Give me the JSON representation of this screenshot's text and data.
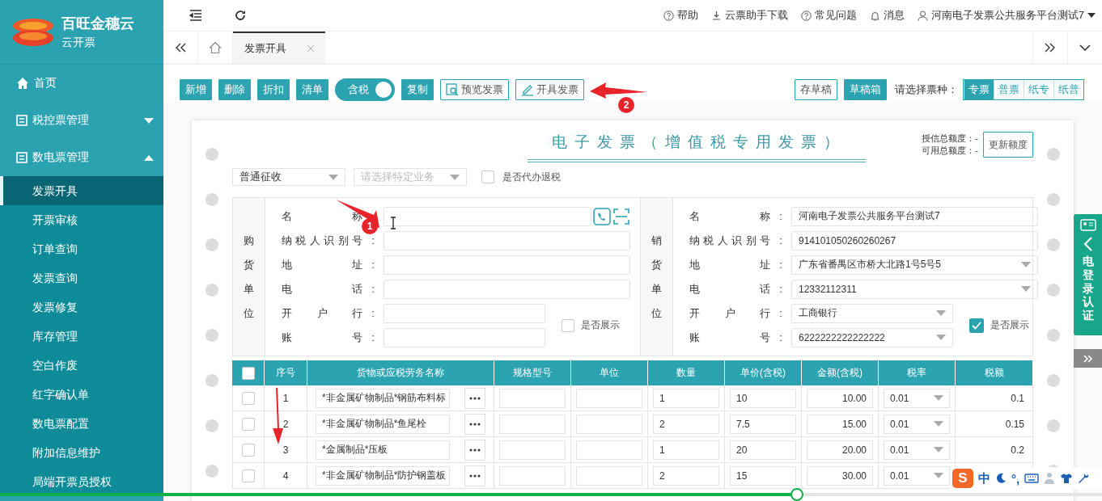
{
  "sidebar": {
    "logo": {
      "title": "百旺金穗云",
      "subtitle": "云开票"
    },
    "items": [
      {
        "kind": "home",
        "label": "首页"
      },
      {
        "kind": "group",
        "label": "税控票管理",
        "expanded": false
      },
      {
        "kind": "group",
        "label": "数电票管理",
        "expanded": true,
        "children": [
          {
            "label": "发票开具",
            "selected": true
          },
          {
            "label": "开票审核",
            "selected": false
          },
          {
            "label": "订单查询",
            "selected": false
          },
          {
            "label": "发票查询",
            "selected": false
          },
          {
            "label": "发票修复",
            "selected": false
          },
          {
            "label": "库存管理",
            "selected": false
          },
          {
            "label": "空白作废",
            "selected": false
          },
          {
            "label": "红字确认单",
            "selected": false
          },
          {
            "label": "数电票配置",
            "selected": false
          },
          {
            "label": "附加信息维护",
            "selected": false
          },
          {
            "label": "局端开票员授权",
            "selected": false
          }
        ]
      }
    ]
  },
  "header": {
    "links": [
      {
        "kind": "help",
        "label": "帮助"
      },
      {
        "kind": "download",
        "label": "云票助手下载"
      },
      {
        "kind": "help",
        "label": "常见问题"
      },
      {
        "kind": "bell",
        "label": "消息"
      }
    ],
    "user": "河南电子发票公共服务平台测试7"
  },
  "tabs": [
    {
      "label": "发票开具",
      "selected": true
    }
  ],
  "toolbar": {
    "left": [
      {
        "kind": "filled",
        "label": "新增"
      },
      {
        "kind": "filled",
        "label": "删除"
      },
      {
        "kind": "filled",
        "label": "折扣"
      },
      {
        "kind": "filled",
        "label": "清单"
      },
      {
        "kind": "toggle",
        "label": "含税",
        "on": true
      },
      {
        "kind": "filled",
        "label": "复制"
      },
      {
        "kind": "outline",
        "label": "预览发票"
      },
      {
        "kind": "outline",
        "label": "开具发票"
      }
    ],
    "right": [
      {
        "kind": "outline",
        "label": "存草稿"
      },
      {
        "kind": "filled",
        "label": "草稿箱"
      }
    ],
    "type_label": "请选择票种：",
    "types": [
      {
        "label": "专票",
        "selected": true
      },
      {
        "label": "普票",
        "selected": false
      },
      {
        "label": "纸专",
        "selected": false
      },
      {
        "label": "纸普",
        "selected": false
      }
    ]
  },
  "invoice": {
    "title": "电子发票（增值税专用发票）",
    "quota": [
      "授信总额度：-",
      "可用总额度：-"
    ],
    "quota_button": "更新额度",
    "levy": {
      "value": "普通征收"
    },
    "business": {
      "placeholder": "请选择特定业务"
    },
    "refund": {
      "label": "是否代办退税",
      "checked": false
    },
    "parties": [
      {
        "side_label": "购货单位",
        "fields": [
          {
            "kind": "lookup",
            "label": "名称"
          },
          {
            "kind": "text",
            "label": "纳税人识别号",
            "sep": ":"
          },
          {
            "kind": "text",
            "label": "地址",
            "sep": ":"
          },
          {
            "kind": "text",
            "label": "电话",
            "sep": ":"
          },
          {
            "kind": "text",
            "label": "开户行",
            "sep": ":"
          },
          {
            "kind": "text",
            "label": "账号",
            "sep": ":"
          }
        ],
        "show": {
          "label": "是否展示",
          "checked": false
        }
      },
      {
        "side_label": "销货单位",
        "fields": [
          {
            "kind": "text",
            "label": "名称",
            "sep": ":",
            "value": "河南电子发票公共服务平台测试7"
          },
          {
            "kind": "text",
            "label": "纳税人识别号",
            "sep": ":",
            "value": "914101050260260267"
          },
          {
            "kind": "select",
            "label": "地址",
            "sep": ":",
            "value": "广东省番禺区市桥大北路1号5号5"
          },
          {
            "kind": "select",
            "label": "电话",
            "sep": ":",
            "value": "12332112311"
          },
          {
            "kind": "select",
            "label": "开户行",
            "sep": ":",
            "value": "工商银行"
          },
          {
            "kind": "select",
            "label": "账号",
            "sep": ":",
            "value": "6222222222222222"
          }
        ],
        "show": {
          "label": "是否展示",
          "checked": true
        }
      }
    ],
    "table": {
      "all_checked": false,
      "columns": [
        "序号",
        "货物或应税劳务名称",
        "规格型号",
        "单位",
        "数量",
        "单价(含税)",
        "金额(含税)",
        "税率",
        "税额"
      ],
      "rows": [
        {
          "checked": false,
          "no": "1",
          "name": "*非金属矿物制品*钢筋布料标",
          "qty": "1",
          "price": "10",
          "amount": "10.00",
          "rate": "0.01",
          "tax": "0.1"
        },
        {
          "checked": false,
          "no": "2",
          "name": "*非金属矿物制品*鱼尾栓",
          "qty": "2",
          "price": "7.5",
          "amount": "15.00",
          "rate": "0.01",
          "tax": "0.15"
        },
        {
          "checked": false,
          "no": "3",
          "name": "*金属制品*压板",
          "qty": "1",
          "price": "20",
          "amount": "20.00",
          "rate": "0.01",
          "tax": "0.2"
        },
        {
          "checked": false,
          "no": "4",
          "name": "*非金属矿物制品*防护钢盖板",
          "qty": "2",
          "price": "15",
          "amount": "30.00",
          "rate": "0.01"
        }
      ]
    }
  },
  "side_panel": {
    "label": "电登录认证"
  },
  "annotations": [
    {
      "kind": "arrow",
      "label": "1"
    },
    {
      "kind": "arrow",
      "label": "2"
    },
    {
      "kind": "arrow"
    }
  ],
  "video": {
    "level": 0.723
  },
  "ime": {
    "logo": "S",
    "mode": "中",
    "punct": "°,"
  }
}
